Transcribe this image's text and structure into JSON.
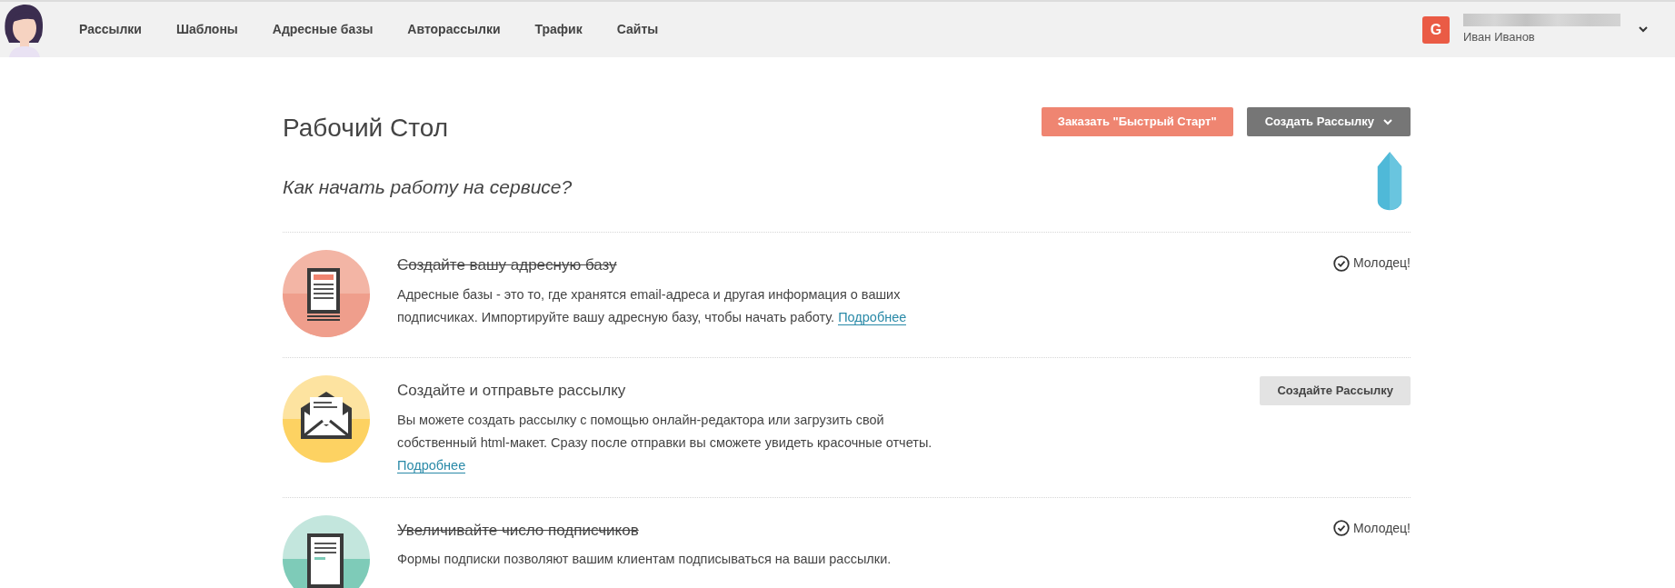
{
  "nav": {
    "items": [
      {
        "label": "Рассылки"
      },
      {
        "label": "Шаблоны"
      },
      {
        "label": "Адресные базы"
      },
      {
        "label": "Авторассылки"
      },
      {
        "label": "Трафик"
      },
      {
        "label": "Сайты"
      }
    ]
  },
  "user": {
    "initial": "G",
    "name": "Иван Иванов"
  },
  "page": {
    "title": "Рабочий Стол",
    "buttons": [
      {
        "kind": "primary",
        "label": "Заказать \"Быстрый Старт\""
      },
      {
        "kind": "dropdown",
        "label": "Создать Рассылку"
      }
    ]
  },
  "guide": {
    "heading": "Как начать работу на сервисе?",
    "steps": [
      {
        "title": "Создайте вашу адресную базу",
        "done": true,
        "description": "Адресные базы - это то, где хранятся email-адреса и другая информация о ваших подписчиках. Импортируйте вашу адресную базу, чтобы начать работу.",
        "link": "Подробнее",
        "action": {
          "kind": "status",
          "label": "Молодец!"
        }
      },
      {
        "title": "Создайте и отправьте рассылку",
        "done": false,
        "description": "Вы можете создать рассылку с помощью онлайн-редактора или загрузить свой собственный html-макет. Сразу после отправки вы сможете увидеть красочные отчеты.",
        "link": "Подробнее",
        "action": {
          "kind": "button",
          "label": "Создайте Рассылку"
        }
      },
      {
        "title": "Увеличивайте число подписчиков",
        "done": true,
        "description": "Формы подписки позволяют вашим клиентам подписываться на ваши рассылки.",
        "action": {
          "kind": "status",
          "label": "Молодец!"
        }
      }
    ]
  }
}
